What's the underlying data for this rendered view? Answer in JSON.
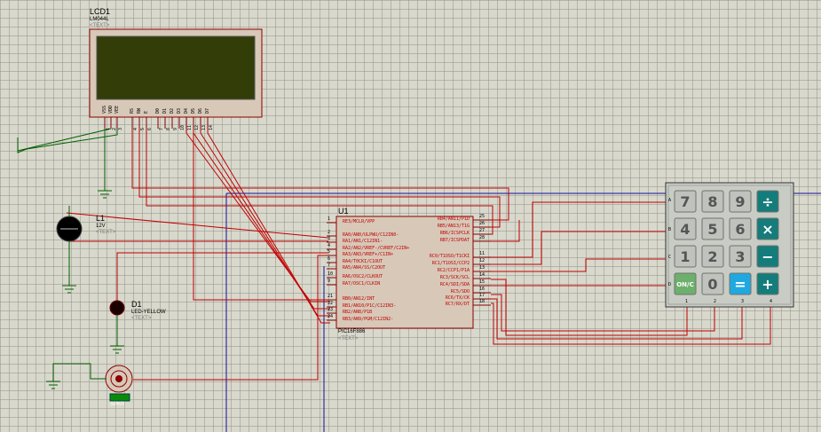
{
  "lcd": {
    "name": "LCD1",
    "part": "LM044L",
    "text": "<TEXT>",
    "pins": [
      "VSS",
      "VDD",
      "VEE",
      "RS",
      "RW",
      "E",
      "D0",
      "D1",
      "D2",
      "D3",
      "D4",
      "D5",
      "D6",
      "D7"
    ],
    "pin_numbers": [
      "1",
      "2",
      "3",
      "4",
      "5",
      "6",
      "7",
      "8",
      "9",
      "10",
      "11",
      "12",
      "13",
      "14"
    ]
  },
  "mcu": {
    "name": "U1",
    "part": "PIC16F886",
    "text": "<TEXT>",
    "left_pins": [
      {
        "num": "1",
        "label": "RE3/MCLR/VPP"
      },
      {
        "num": "2",
        "label": "RA0/AN0/ULPWU/C12IN0-"
      },
      {
        "num": "3",
        "label": "RA1/AN1/C12IN1-"
      },
      {
        "num": "4",
        "label": "RA2/AN2/VREF-/CVREF/C2IN+"
      },
      {
        "num": "5",
        "label": "RA3/AN3/VREF+/C1IN+"
      },
      {
        "num": "6",
        "label": "RA4/T0CKI/C1OUT"
      },
      {
        "num": "7",
        "label": "RA5/AN4/SS/C2OUT"
      },
      {
        "num": "10",
        "label": "RA6/OSC2/CLKOUT"
      },
      {
        "num": "9",
        "label": "RA7/OSC1/CLKIN"
      },
      {
        "num": "21",
        "label": "RB0/AN12/INT"
      },
      {
        "num": "22",
        "label": "RB1/AN10/P1C/C12IN3-"
      },
      {
        "num": "23",
        "label": "RB2/AN8/P1B"
      },
      {
        "num": "24",
        "label": "RB3/AN9/PGM/C12IN2-"
      }
    ],
    "right_pins": [
      {
        "num": "25",
        "label": "RB4/AN11/P1D"
      },
      {
        "num": "26",
        "label": "RB5/AN13/T1G"
      },
      {
        "num": "27",
        "label": "RB6/ICSPCLK"
      },
      {
        "num": "28",
        "label": "RB7/ICSPDAT"
      },
      {
        "num": "11",
        "label": "RC0/T1OSO/T1CKI"
      },
      {
        "num": "12",
        "label": "RC1/T1OSI/CCP2"
      },
      {
        "num": "13",
        "label": "RC2/CCP1/P1A"
      },
      {
        "num": "14",
        "label": "RC3/SCK/SCL"
      },
      {
        "num": "15",
        "label": "RC4/SDI/SDA"
      },
      {
        "num": "16",
        "label": "RC5/SDO"
      },
      {
        "num": "17",
        "label": "RC6/TX/CK"
      },
      {
        "num": "18",
        "label": "RC7/RX/DT"
      }
    ]
  },
  "lamp": {
    "name": "L1",
    "part": "12V",
    "text": "<TEXT>"
  },
  "led": {
    "name": "D1",
    "part": "LED-YELLOW",
    "text": "<TEXT>"
  },
  "buzzer": {
    "part": "SPKR"
  },
  "keypad": {
    "row_labels": [
      "A",
      "B",
      "C",
      "D"
    ],
    "col_labels": [
      "1",
      "2",
      "3",
      "4"
    ],
    "keys": [
      [
        "7",
        "8",
        "9",
        "÷"
      ],
      [
        "4",
        "5",
        "6",
        "×"
      ],
      [
        "1",
        "2",
        "3",
        "−"
      ],
      [
        "ON/C",
        "0",
        "=",
        "+"
      ]
    ]
  },
  "colors": {
    "wire": "#c00000",
    "body_fill": "#d7c8b8",
    "lcd_screen": "#333d08",
    "rail": "#1010a0",
    "ground": "#006000",
    "key_gray": "#bfc2bd",
    "key_teal": "#157c7c",
    "key_blue": "#20a8e0",
    "key_green": "#6db06d"
  }
}
